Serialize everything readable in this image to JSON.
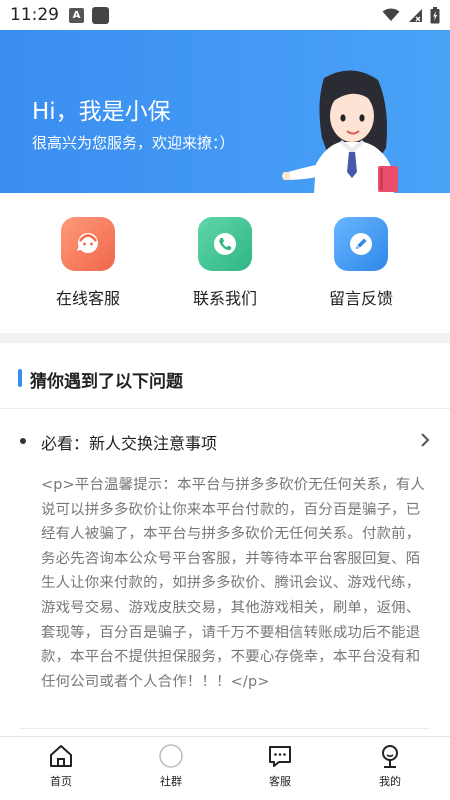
{
  "status_bar": {
    "time": "11:29",
    "notification_letter": "A"
  },
  "hero": {
    "title": "Hi，我是小保",
    "subtitle": "很高兴为您服务，欢迎来撩：）",
    "background_color": "#3a8ef0"
  },
  "actions": [
    {
      "label": "在线客服",
      "icon": "chat-agent-icon",
      "color": "#f47a5c"
    },
    {
      "label": "联系我们",
      "icon": "phone-icon",
      "color": "#34c08e"
    },
    {
      "label": "留言反馈",
      "icon": "pencil-icon",
      "color": "#3d95ef"
    }
  ],
  "section": {
    "title": "猜你遇到了以下问题",
    "accent_color": "#3a8ef0"
  },
  "faq": {
    "title": "必看：新人交换注意事项",
    "body": "<p>平台温馨提示：本平台与拼多多砍价无任何关系，有人说可以拼多多砍价让你来本平台付款的，百分百是骗子，已经有人被骗了，本平台与拼多多砍价无任何关系。付款前，务必先咨询本公众号平台客服，并等待本平台客服回复、陌生人让你来付款的，如拼多多砍价、腾讯会议、游戏代练，游戏号交易、游戏皮肤交易，其他游戏相关，刷单，返佣、套现等，百分百是骗子，请千万不要相信转账成功后不能退款，本平台不提供担保服务，不要心存侥幸，本平台没有和任何公司或者个人合作！！！</p>"
  },
  "bottom_nav": [
    {
      "label": "首页",
      "icon": "home-icon"
    },
    {
      "label": "社群",
      "icon": "community-icon"
    },
    {
      "label": "客服",
      "icon": "customer-service-icon"
    },
    {
      "label": "我的",
      "icon": "profile-icon"
    }
  ]
}
